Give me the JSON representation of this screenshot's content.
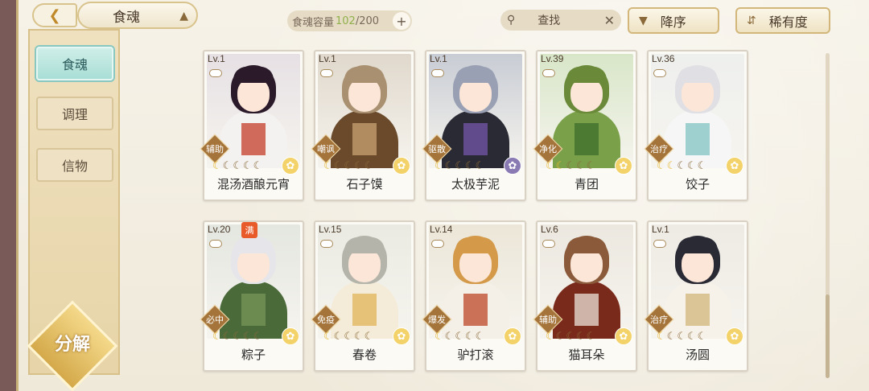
{
  "header": {
    "back_icon": "back-arrow-icon",
    "title": "食魂",
    "capacity_label": "食魂容量",
    "capacity_current": "102",
    "capacity_max": "/200",
    "capacity_plus": "+",
    "search_placeholder": "查找",
    "sort_order_label": "降序",
    "sort_key_label": "稀有度"
  },
  "sidebar": {
    "items": [
      {
        "label": "食魂",
        "active": true
      },
      {
        "label": "调理",
        "active": false
      },
      {
        "label": "信物",
        "active": false
      }
    ],
    "decompose_label": "分解"
  },
  "cards": [
    {
      "level": "Lv.1",
      "role": "辅助",
      "name": "混汤酒酿元宵",
      "stars_lit": 1,
      "stars_total": 5,
      "bg": "#e6e0e4",
      "hair": "#2a1a2a",
      "outfit": "#f4f2f0",
      "accent": "#c0301a",
      "flower": "yellow"
    },
    {
      "level": "Lv.1",
      "role": "嘲讽",
      "name": "石子馍",
      "stars_lit": 1,
      "stars_total": 5,
      "bg": "#e0d8cc",
      "hair": "#a89070",
      "outfit": "#6a4a2a",
      "accent": "#d0a878",
      "flower": "yellow"
    },
    {
      "level": "Lv.1",
      "role": "驱散",
      "name": "太极芋泥",
      "stars_lit": 1,
      "stars_total": 5,
      "bg": "#c8ccd4",
      "hair": "#9aa0b4",
      "outfit": "#2a2a34",
      "accent": "#7a5ab4",
      "flower": "purple"
    },
    {
      "level": "Lv.39",
      "role": "净化",
      "name": "青团",
      "stars_lit": 2,
      "stars_total": 5,
      "bg": "#d8e6c8",
      "hair": "#6a8a3a",
      "outfit": "#7aa04a",
      "accent": "#3a6a2a",
      "flower": "yellow"
    },
    {
      "level": "Lv.36",
      "role": "治疗",
      "name": "饺子",
      "stars_lit": 2,
      "stars_total": 5,
      "bg": "#eef0ee",
      "hair": "#e0e0e4",
      "outfit": "#f6f6f6",
      "accent": "#7ac0c0",
      "flower": "yellow"
    },
    {
      "level": "Lv.20",
      "role": "必中",
      "name": "粽子",
      "stars_lit": 1,
      "stars_total": 5,
      "bg": "#e4e6e0",
      "hair": "#e6e6ea",
      "outfit": "#4a6a3a",
      "accent": "#7a9a5a",
      "flower": "yellow",
      "full_badge": "满"
    },
    {
      "level": "Lv.15",
      "role": "免疫",
      "name": "春卷",
      "stars_lit": 1,
      "stars_total": 5,
      "bg": "#eaeae2",
      "hair": "#b4b4aa",
      "outfit": "#f4ecd8",
      "accent": "#e0b050",
      "flower": "yellow"
    },
    {
      "level": "Lv.14",
      "role": "爆发",
      "name": "驴打滚",
      "stars_lit": 1,
      "stars_total": 5,
      "bg": "#ece6d8",
      "hair": "#d49a4a",
      "outfit": "#f4f0e8",
      "accent": "#b83a1a",
      "flower": "yellow"
    },
    {
      "level": "Lv.6",
      "role": "辅助",
      "name": "猫耳朵",
      "stars_lit": 1,
      "stars_total": 5,
      "bg": "#ece8e0",
      "hair": "#8a5a3a",
      "outfit": "#7a2a1a",
      "accent": "#f4f0e8",
      "flower": "yellow"
    },
    {
      "level": "Lv.1",
      "role": "治疗",
      "name": "汤圆",
      "stars_lit": 1,
      "stars_total": 5,
      "bg": "#eeeae4",
      "hair": "#2a2a34",
      "outfit": "#f6f2ea",
      "accent": "#d0b070",
      "flower": "yellow"
    }
  ],
  "icons": {
    "magnifier": "search-icon",
    "clear": "close-icon",
    "sort_order": "triangle-down-icon",
    "sort_key": "sort-icon",
    "flower": "flower-icon",
    "star": "star-icon"
  }
}
